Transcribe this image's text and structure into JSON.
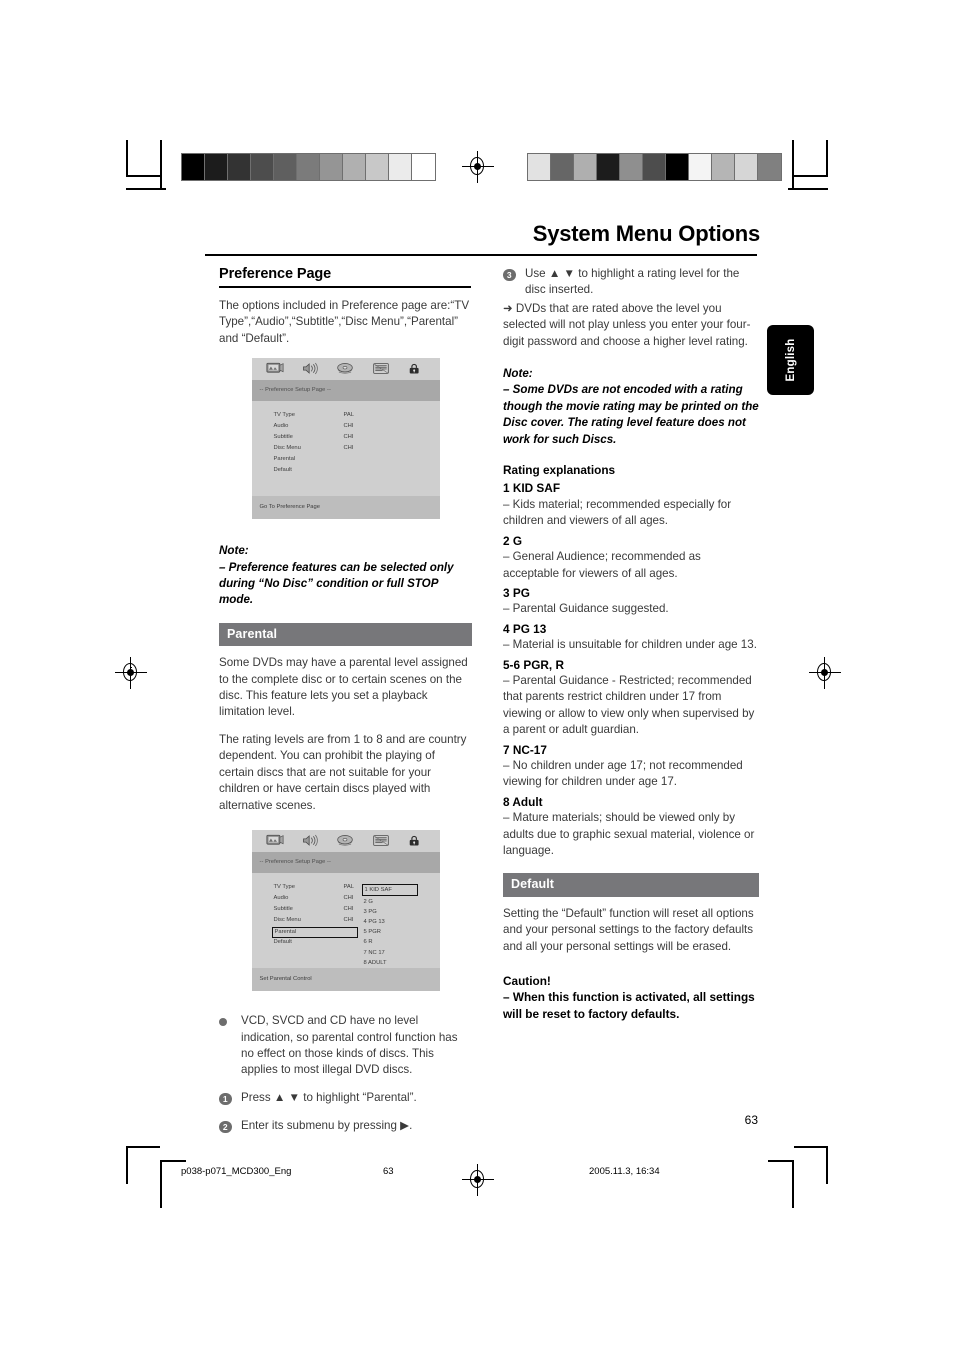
{
  "page": {
    "title": "System Menu Options",
    "page_number": "63",
    "language_tab": "English"
  },
  "footer": {
    "file": "p038-p071_MCD300_Eng",
    "page": "63",
    "date": "2005.11.3, 16:34"
  },
  "swatch_bars": {
    "left": [
      "#000000",
      "#1c1c1c",
      "#333333",
      "#4d4d4d",
      "#5f5f5f",
      "#7b7b7b",
      "#959595",
      "#b0b0b0",
      "#c8c8c8",
      "#ebebeb",
      "#ffffff"
    ],
    "right": [
      "#e2e2e2",
      "#666666",
      "#afafaf",
      "#1c1c1c",
      "#8f8f8f",
      "#4d4d4d",
      "#000000",
      "#f4f4f4",
      "#b5b5b5",
      "#d6d6d6",
      "#808080"
    ]
  },
  "colors": {
    "band_background": "#77777a",
    "band_text": "#ffffff",
    "body_text": "#3a3a3a",
    "heading_text": "#000000",
    "marker_fill": "#6d6d6d",
    "osd_background": "#cfcfcf",
    "osd_titlebar": "#a8a8a8"
  },
  "left_column": {
    "heading": "Preference Page",
    "intro": "The options included in Preference page are:“TV Type”,“Audio”,“Subtitle”,“Disc Menu”,“Parental” and “Default”.",
    "note_label": "Note:",
    "note_body": "–  Preference features can be selected only during “No Disc” condition or full STOP mode.",
    "parental_band": "Parental",
    "parental_p1": "Some DVDs may have a parental level assigned to the complete disc or to certain scenes on the disc. This feature lets you set a playback limitation level.",
    "parental_p2": "The rating levels are from 1 to 8 and are country dependent. You can prohibit the playing of certain discs that are not suitable for your children or have certain discs played with alternative scenes.",
    "bullet_disc": "VCD, SVCD and CD have no level indication, so parental control function has no effect on those kinds of discs. This applies to most illegal DVD discs.",
    "step1_marker": "1",
    "step1": "Press ▲ ▼  to highlight “Parental”.",
    "step2_marker": "2",
    "step2": "Enter its submenu by pressing ▶."
  },
  "osd_screen_1": {
    "icons": [
      "tv-icon",
      "audio-icon",
      "video-disc-icon",
      "subtitle-icon",
      "lock-icon"
    ],
    "title": "-- Preference Setup Page --",
    "rows": [
      {
        "label": "TV Type",
        "value": "PAL"
      },
      {
        "label": "Audio",
        "value": "CHI"
      },
      {
        "label": "Subtitle",
        "value": "CHI"
      },
      {
        "label": "Disc Menu",
        "value": "CHI"
      },
      {
        "label": "Parental",
        "value": ""
      },
      {
        "label": "Default",
        "value": ""
      }
    ],
    "footer": "Go To Preference Page"
  },
  "osd_screen_2": {
    "icons": [
      "tv-icon",
      "audio-icon",
      "video-disc-icon",
      "subtitle-icon",
      "lock-icon"
    ],
    "title": "-- Preference Setup Page --",
    "rows": [
      {
        "label": "TV Type",
        "value": "PAL",
        "selected": false
      },
      {
        "label": "Audio",
        "value": "CHI",
        "selected": false
      },
      {
        "label": "Subtitle",
        "value": "CHI",
        "selected": false
      },
      {
        "label": "Disc Menu",
        "value": "CHI",
        "selected": false
      },
      {
        "label": "Parental",
        "value": "",
        "selected": true
      },
      {
        "label": "Default",
        "value": "",
        "selected": false
      }
    ],
    "rating_list": [
      "1 KID SAF",
      "2 G",
      "3 PG",
      "4 PG 13",
      "5 PGR",
      "6 R",
      "7 NC 17",
      "8 ADULT"
    ],
    "rating_highlighted": "1 KID SAF",
    "footer": "Set Parental Control"
  },
  "right_column": {
    "step3_marker": "3",
    "step3_line1": "Use ▲ ▼  to highlight a rating level for the disc inserted.",
    "step3_line2": "➜ DVDs that are rated above the level you selected will not play unless you enter your four-digit password and choose a higher level rating.",
    "note_label": "Note:",
    "note_body": "–  Some DVDs are not encoded with a rating though the movie rating may be printed on the Disc cover. The rating level feature does not work for such Discs.",
    "ratings_heading": "Rating explanations",
    "ratings": [
      {
        "title": "1 KID SAF",
        "desc": "–   Kids material; recommended especially for children and viewers of all ages."
      },
      {
        "title": "2 G",
        "desc": "–   General Audience; recommended as acceptable for viewers of all ages."
      },
      {
        "title": "3 PG",
        "desc": "–   Parental Guidance suggested."
      },
      {
        "title": "4 PG 13",
        "desc": "–   Material is unsuitable for children under age 13."
      },
      {
        "title": "5-6 PGR, R",
        "desc": "–   Parental Guidance - Restricted; recommended that parents restrict children under 17 from viewing or allow to view only when supervised by a parent or adult guardian."
      },
      {
        "title": "7 NC-17",
        "desc": "–   No children under age 17; not recommended viewing for children under age 17."
      },
      {
        "title": "8 Adult",
        "desc": "–   Mature materials; should be viewed only by adults due to graphic sexual material, violence or language."
      }
    ],
    "default_band": "Default",
    "default_body": "Setting the “Default” function will reset all options and your personal settings to the factory defaults and all your personal settings will be erased.",
    "caution_head": "Caution!",
    "caution_body": "–   When this function is activated, all settings will be reset to factory defaults."
  }
}
